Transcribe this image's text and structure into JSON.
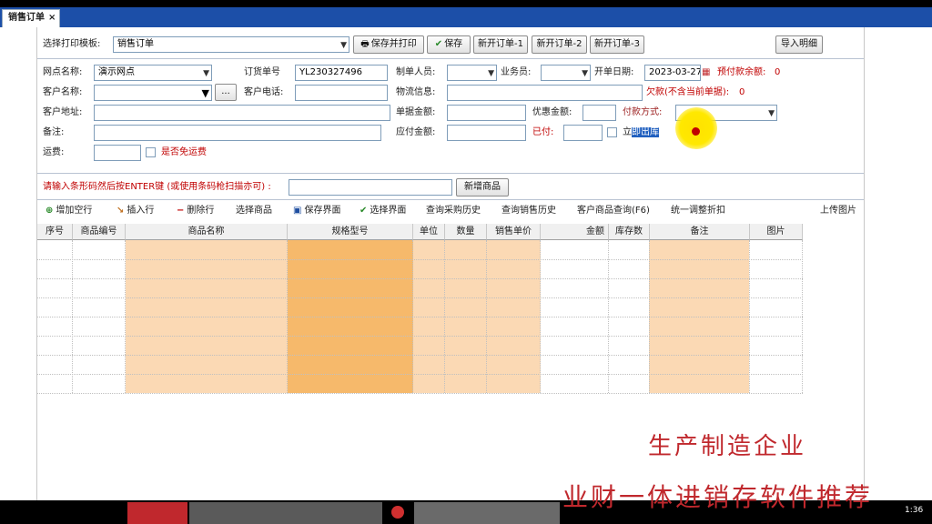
{
  "tabs": [
    {
      "label": "销售订单",
      "close": "×"
    }
  ],
  "toolbar": {
    "template_label": "选择打印模板:",
    "template_value": "销售订单",
    "save_print": "保存并打印",
    "save": "保存",
    "new_order_1": "新开订单-1",
    "new_order_2": "新开订单-2",
    "new_order_3": "新开订单-3",
    "import_detail": "导入明细"
  },
  "form": {
    "outlet_label": "网点名称:",
    "outlet_value": "演示网点",
    "order_no_label": "订货单号",
    "order_no_value": "YL230327496",
    "maker_label": "制单人员:",
    "salesman_label": "业务员:",
    "open_date_label": "开单日期:",
    "open_date_value": "2023-03-27",
    "prepay_label": "预付款余额:",
    "prepay_value": "0",
    "customer_label": "客户名称:",
    "browse_button": "...",
    "phone_label": "客户电话:",
    "logistics_label": "物流信息:",
    "arrears_label": "欠款(不含当前单据):",
    "arrears_value": "0",
    "address_label": "客户地址:",
    "bill_amount_label": "单据金额:",
    "discount_label": "优惠金额:",
    "payment_method_label": "付款方式:",
    "remark_label": "备注:",
    "payable_label": "应付金额:",
    "paid_label": "已付:",
    "instant_out_prefix": "立",
    "instant_out_selected": "即出库",
    "freight_label": "运费:",
    "free_freight_label": "是否免运费"
  },
  "barcode": {
    "label": "请输入条形码然后按ENTER键 (或使用条码枪扫描亦可) :",
    "add_button": "新增商品"
  },
  "grid_toolbar": {
    "add_row": "增加空行",
    "insert_row": "插入行",
    "delete_row": "删除行",
    "select_goods": "选择商品",
    "save_view": "保存界面",
    "select_view": "选择界面",
    "purchase_history": "查询采购历史",
    "sales_history": "查询销售历史",
    "customer_goods": "客户商品查询(F6)",
    "batch_discount": "统一调整折扣",
    "upload_image": "上传图片"
  },
  "grid": {
    "columns": [
      "序号",
      "商品编号",
      "商品名称",
      "规格型号",
      "单位",
      "数量",
      "销售单价",
      "金额",
      "库存数",
      "备注",
      "图片"
    ],
    "row_count": 8
  },
  "overlay": {
    "line1": "生产制造企业",
    "line2": "业财一体进销存软件推荐"
  },
  "taskbar": {
    "clock": "1:36"
  },
  "colors": {
    "tab_bar": "#1c4fa8",
    "highlight_col": "#fbd9b4",
    "highlight_col_strong": "#f6b96b",
    "overlay_text": "#c0282d",
    "label_red": "#c00000"
  }
}
